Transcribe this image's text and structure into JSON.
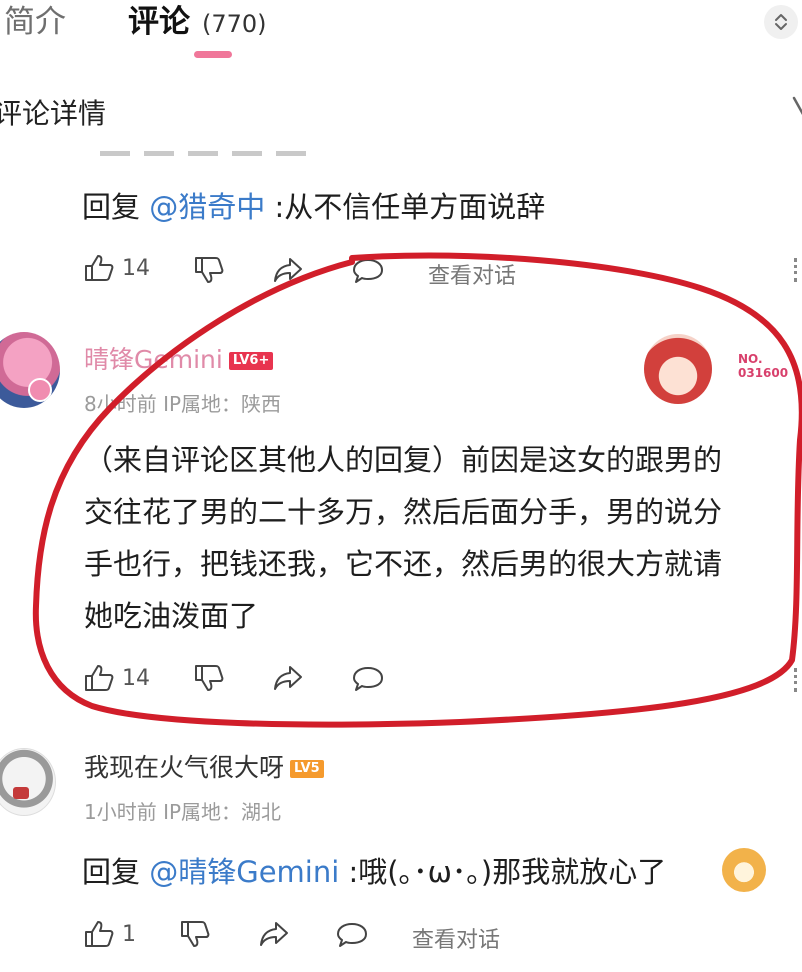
{
  "tabs": {
    "intro": "简介",
    "comments": "评论",
    "comment_count": "(770)"
  },
  "detail": {
    "title": "评论详情"
  },
  "reply1": {
    "prefix": "回复",
    "mention": "@猎奇中",
    "text": ":从不信任单方面说辞",
    "likes": "14",
    "view_conversation": "查看对话"
  },
  "comment_main": {
    "username": "晴锋Gemini",
    "level": "LV6+",
    "meta": "8小时前  IP属地：陕西",
    "fan_badge_no": "NO.",
    "fan_badge_num": "031600",
    "lines": [
      "（来自评论区其他人的回复）前因是这女的跟男的",
      "交往花了男的二十多万，然后后面分手，男的说分",
      "手也行，把钱还我，它不还，然后男的很大方就请",
      "她吃油泼面了"
    ],
    "likes": "14"
  },
  "comment_reply": {
    "username": "我现在火气很大呀",
    "level": "LV5",
    "meta": "1小时前  IP属地：湖北",
    "prefix": "回复",
    "mention": "@晴锋Gemini",
    "text": ":哦(｡･ω･｡)那我就放心了",
    "likes": "1",
    "view_conversation": "查看对话"
  },
  "colors": {
    "accent": "#f0779a",
    "mention": "#3b7bc9",
    "username_vip": "#e08aa8",
    "annotation": "#d11e2a",
    "level_red": "#e8344f",
    "level_orange": "#f59a2d"
  },
  "icons": [
    "thumb-up-icon",
    "thumb-down-icon",
    "share-icon",
    "comment-icon",
    "sort-icon",
    "emoji-doge-icon"
  ]
}
